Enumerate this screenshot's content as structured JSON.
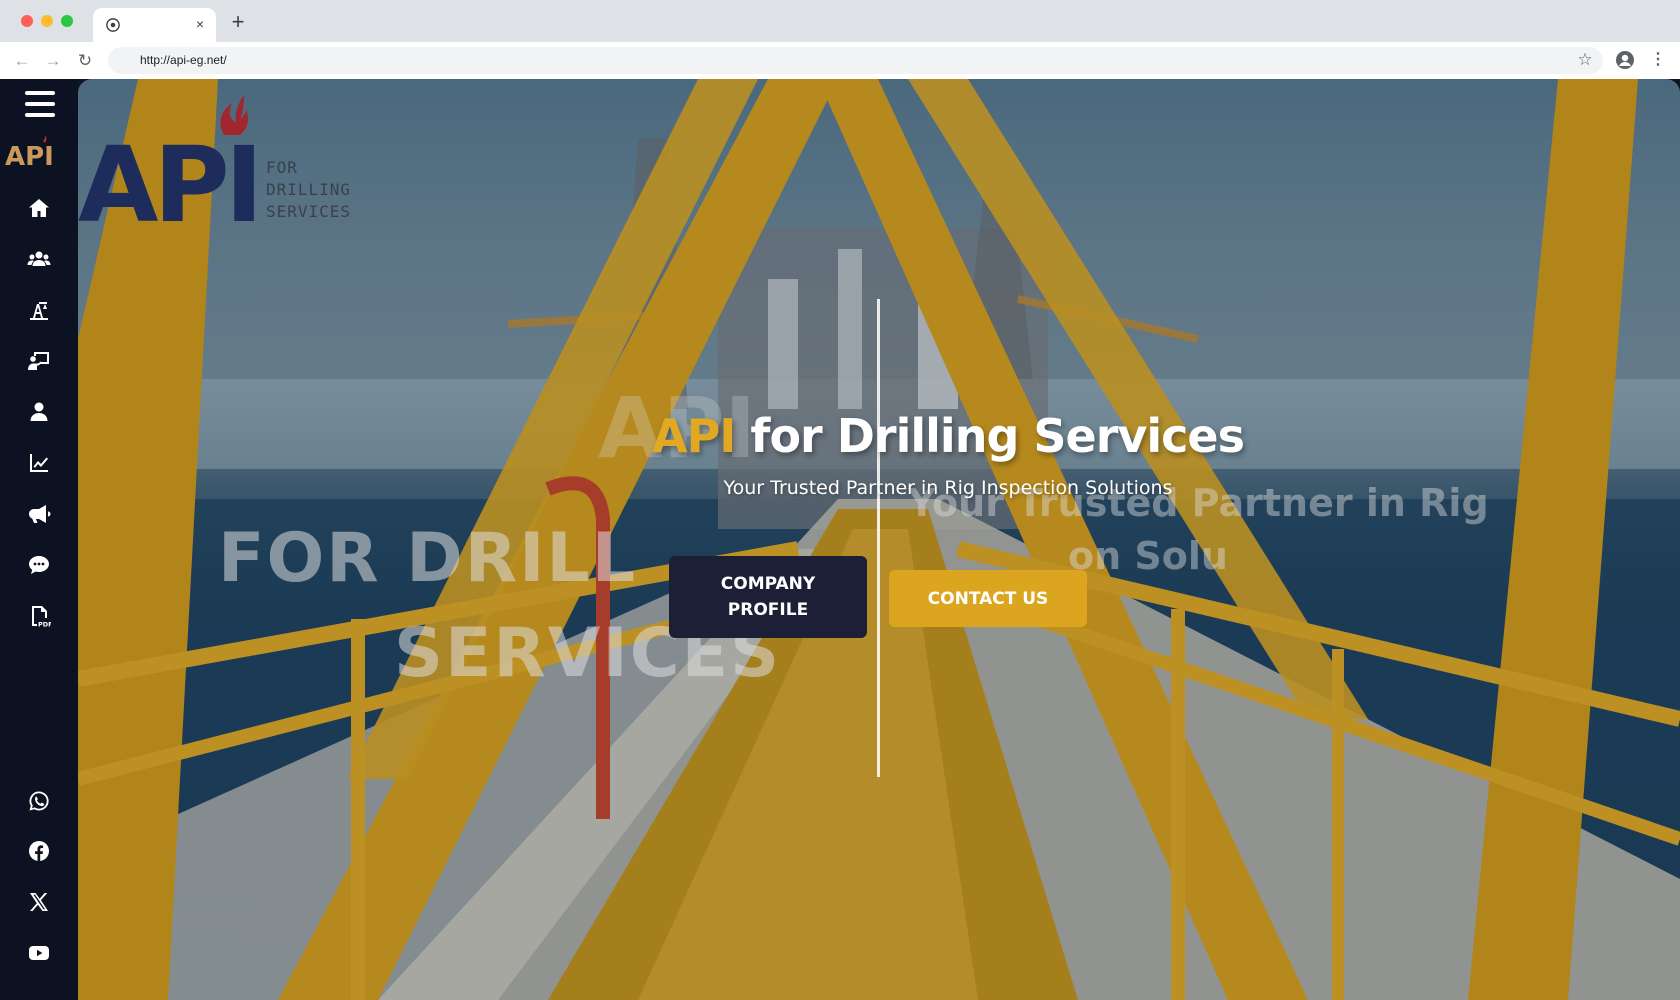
{
  "browser": {
    "tab_close": "×",
    "new_tab": "+",
    "url": "http://api-eg.net/"
  },
  "sidebar": {
    "logo_text": "API",
    "nav_icons": [
      "home-icon",
      "users-icon",
      "oil-rig-icon",
      "training-icon",
      "user-icon",
      "chart-icon",
      "megaphone-icon",
      "chat-icon",
      "pdf-icon"
    ],
    "social_icons": [
      "whatsapp-icon",
      "facebook-icon",
      "x-icon",
      "youtube-icon"
    ]
  },
  "logo": {
    "mark": "API",
    "tagline_lines": [
      "FOR",
      "DRILLING",
      "SERVICES"
    ]
  },
  "hero": {
    "title_accent": "API",
    "title_rest": " for Drilling Services",
    "subtitle": "Your Trusted Partner in Rig Inspection Solutions",
    "ghost_line_1": "FOR DRILL",
    "ghost_line_2": "SERVICES",
    "ghost_right_1": "Your Trusted Partner in Rig",
    "ghost_right_2": "on Solu",
    "ghost_api": "API",
    "buttons": {
      "company_profile": "COMPANY PROFILE",
      "contact_us": "CONTACT US"
    }
  },
  "colors": {
    "accent": "#e1a923",
    "sidebar_bg": "#0d1222",
    "button_dark": "#1c1f36",
    "button_gold": "#dba51f"
  }
}
